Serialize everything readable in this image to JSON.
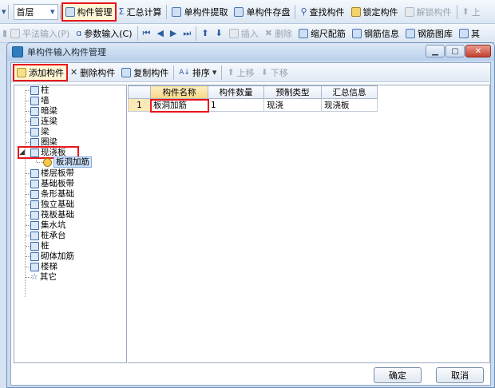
{
  "toolbar1": {
    "floor": "首层",
    "items": [
      "构件管理",
      "汇总计算",
      "单构件提取",
      "单构件存盘",
      "查找构件",
      "锁定构件",
      "解锁构件",
      "上"
    ]
  },
  "toolbar2": {
    "items": [
      "平法输入(P)",
      "参数输入(C)",
      "插入",
      "删除",
      "缩尺配筋",
      "钢筋信息",
      "钢筋图库",
      "其"
    ]
  },
  "dialog": {
    "title": "单构件输入构件管理",
    "toolbar": {
      "add": "添加构件",
      "delete": "删除构件",
      "copy": "复制构件",
      "sort": "排序",
      "up": "上移",
      "down": "下移"
    },
    "tree": {
      "nodes": [
        "柱",
        "墙",
        "暗梁",
        "连梁",
        "梁",
        "圈梁",
        "现浇板",
        "板洞加筋",
        "楼层板带",
        "基础板带",
        "条形基础",
        "独立基础",
        "筏板基础",
        "集水坑",
        "桩承台",
        "桩",
        "砌体加筋",
        "楼梯",
        "其它"
      ],
      "expander": "◢"
    },
    "grid": {
      "headers": [
        "构件名称",
        "构件数量",
        "预制类型",
        "汇总信息"
      ],
      "rows": [
        {
          "num": "1",
          "name": "板洞加筋",
          "count": "1",
          "type": "现浇",
          "summary": "现浇板"
        }
      ]
    },
    "ok": "确定",
    "cancel": "取消"
  },
  "colors": {
    "highlight": "#e8151b",
    "accent": "#2e7dc1"
  }
}
